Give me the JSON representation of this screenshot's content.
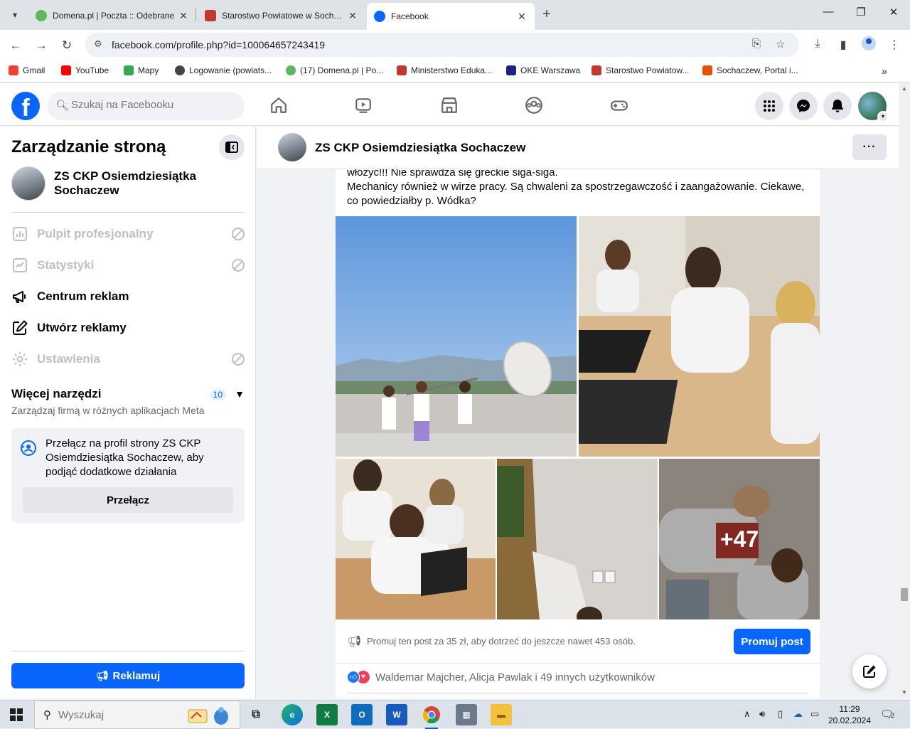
{
  "browser": {
    "tabs": [
      {
        "title": "Domena.pl | Poczta :: Odebrane",
        "favicon_color": "#5cb85c",
        "active": false
      },
      {
        "title": "Starostwo Powiatowe w Sochaczewie",
        "favicon_color": "#c0392b",
        "active": false
      },
      {
        "title": "Facebook",
        "favicon_color": "#0866ff",
        "active": true
      }
    ],
    "url": "facebook.com/profile.php?id=100064657243419",
    "bookmarks": [
      {
        "label": "Gmail",
        "color": "#ea4335"
      },
      {
        "label": "YouTube",
        "color": "#ff0000"
      },
      {
        "label": "Mapy",
        "color": "#34a853"
      },
      {
        "label": "Logowanie (powiats...",
        "color": "#444444"
      },
      {
        "label": "(17) Domena.pl | Po...",
        "color": "#5cb85c"
      },
      {
        "label": "Ministerstwo Eduka...",
        "color": "#c0392b"
      },
      {
        "label": "OKE Warszawa",
        "color": "#1a237e"
      },
      {
        "label": "Starostwo Powiatow...",
        "color": "#c0392b"
      },
      {
        "label": "Sochaczew, Portal i...",
        "color": "#e65100"
      }
    ]
  },
  "facebook": {
    "search_placeholder": "Szukaj na Facebooku",
    "brand_color": "#0866ff"
  },
  "left_panel": {
    "title": "Zarządzanie stroną",
    "page_name": "ZS CKP Osiemdziesiątka Sochaczew",
    "menu": [
      {
        "label": "Pulpit profesjonalny",
        "disabled": true,
        "icon": "dashboard-icon"
      },
      {
        "label": "Statystyki",
        "disabled": true,
        "icon": "stats-icon"
      },
      {
        "label": "Centrum reklam",
        "disabled": false,
        "icon": "megaphone-icon"
      },
      {
        "label": "Utwórz reklamy",
        "disabled": false,
        "icon": "pencil-square-icon"
      },
      {
        "label": "Ustawienia",
        "disabled": true,
        "icon": "gear-icon"
      }
    ],
    "more_tools": {
      "title": "Więcej narzędzi",
      "count": "10",
      "subtitle": "Zarządzaj firmą w różnych aplikacjach Meta"
    },
    "switch_card": {
      "text": "Przełącz na profil strony ZS CKP Osiemdziesiątka Sochaczew, aby podjąć dodatkowe działania",
      "button": "Przełącz"
    },
    "ad_button": "Reklamuj"
  },
  "main": {
    "page_name": "ZS CKP Osiemdziesiątka Sochaczew",
    "post": {
      "text_lines": [
        "włożyć!!! Nie sprawdza się greckie siga-siga.",
        "Mechanicy również w wirze pracy. Są chwaleni za spostrzegawczość i zaangażowanie. Ciekawe, co powiedziałby p. Wódka?"
      ],
      "more_photos": "+47",
      "promo_text": "Promuj ten post za 35 zł, aby dotrzeć do jeszcze nawet 453 osób.",
      "promo_button": "Promuj post",
      "reactions_text": "Waldemar Majcher, Alicja Pawlak i 49 innych użytkowników"
    }
  },
  "taskbar": {
    "search_placeholder": "Wyszukaj",
    "time": "11:29",
    "date": "20.02.2024",
    "notification_count": "2"
  }
}
